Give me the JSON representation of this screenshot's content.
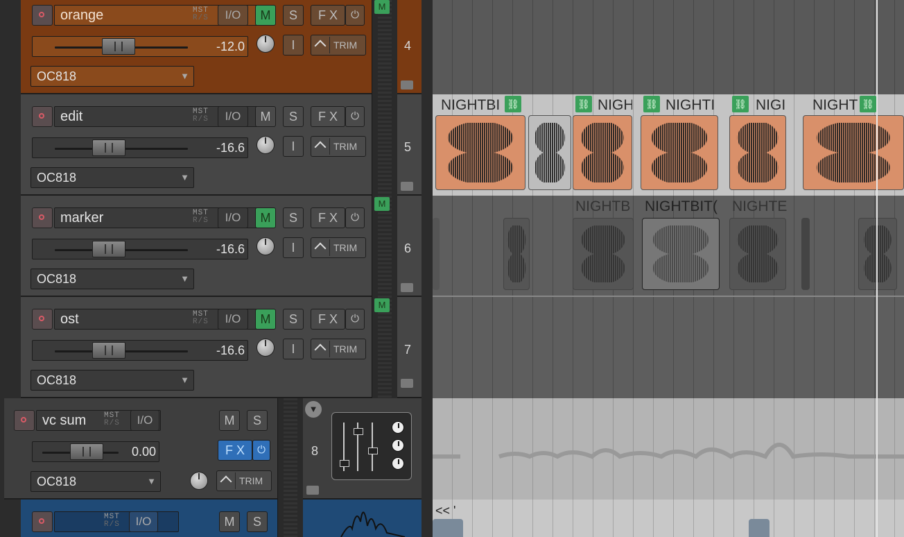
{
  "tracks": [
    {
      "name": "orange",
      "volume": "-12.0",
      "device": "OC818",
      "number": "4",
      "mute_active": true
    },
    {
      "name": "edit",
      "volume": "-16.6",
      "device": "OC818",
      "number": "5",
      "mute_active": false
    },
    {
      "name": "marker",
      "volume": "-16.6",
      "device": "OC818",
      "number": "6",
      "mute_active": true
    },
    {
      "name": "ost",
      "volume": "-16.6",
      "device": "OC818",
      "number": "7",
      "mute_active": true
    },
    {
      "name": "vc sum",
      "volume": "0.00",
      "device": "OC818",
      "number": "8",
      "fx_active": true
    },
    {
      "name": "",
      "number": ""
    }
  ],
  "buttons": {
    "mst": "MST",
    "rs": "R/S",
    "io": "I/O",
    "m": "M",
    "s": "S",
    "fx": "F X",
    "i": "I",
    "trim": "TRIM",
    "power": "⏻"
  },
  "meter_tag": "M",
  "items": {
    "lane5": [
      "NIGHTBI",
      "NIGH",
      "NIGHTI",
      "NIGI",
      "NIGHT"
    ],
    "lane6": [
      "NIGHTB",
      "NIGHTBIT(",
      "NIGHTE"
    ],
    "bottom_label": "<< '"
  },
  "colors": {
    "orange_track": "#7a3a12",
    "selected_item": "#d9906a",
    "mute_green": "#3aa05a",
    "fx_blue": "#2f6fb8"
  }
}
